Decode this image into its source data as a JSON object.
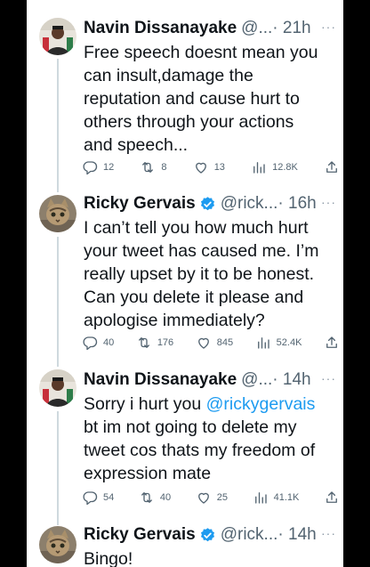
{
  "tweets": [
    {
      "name": "Navin Dissanayake",
      "handle": "@...",
      "time": "· 21h",
      "more": "···",
      "text": "Free speech doesnt mean you\ncan insult,damage the\nreputation and cause hurt to\nothers through your actions\nand speech...",
      "replies": "12",
      "retweets": "8",
      "likes": "13",
      "views": "12.8K",
      "verified": false
    },
    {
      "name": "Ricky Gervais",
      "handle": "@rick...",
      "time": "· 16h",
      "more": "···",
      "text": "I can’t tell you how much hurt\nyour tweet has caused me. I’m\nreally upset by it to be honest.\nCan you delete it please and\napologise immediately?",
      "replies": "40",
      "retweets": "176",
      "likes": "845",
      "views": "52.4K",
      "verified": true
    },
    {
      "name": "Navin Dissanayake",
      "handle": "@...",
      "time": "· 14h",
      "more": "···",
      "text_before": "Sorry i hurt you ",
      "mention": "@rickygervais",
      "text_after": "\nbt im not going to delete my\ntweet cos thats my freedom of\nexpression mate",
      "replies": "54",
      "retweets": "40",
      "likes": "25",
      "views": "41.1K",
      "verified": false
    },
    {
      "name": "Ricky Gervais",
      "handle": "@rick...",
      "time": "· 14h",
      "more": "···",
      "text": "Bingo!",
      "verified": true
    }
  ],
  "colors": {
    "name": "#0f1419",
    "secondary": "#536471",
    "link": "#1d9bf0",
    "verified": "#1d9bf0",
    "thread_line": "#cfd9de"
  },
  "icons": [
    "reply-icon",
    "retweet-icon",
    "like-icon",
    "views-icon",
    "share-icon",
    "verified-badge-icon",
    "more-options-icon"
  ]
}
